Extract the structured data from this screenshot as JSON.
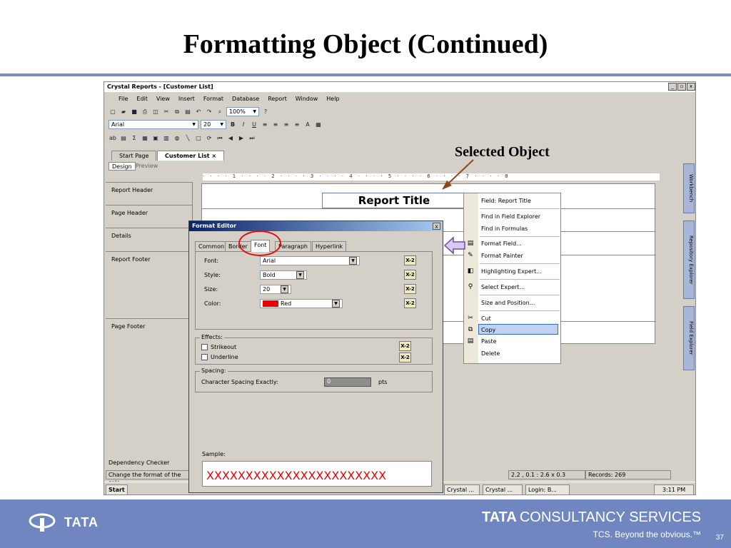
{
  "slide": {
    "title": "Formatting Object (Continued)",
    "annotation": "Selected Object",
    "page_number": "37"
  },
  "window": {
    "title": "Crystal Reports - [Customer List]",
    "buttons": [
      "_",
      " Γ",
      "x"
    ]
  },
  "menu": [
    "File",
    "Edit",
    "View",
    "Insert",
    "Format",
    "Database",
    "Report",
    "Window",
    "Help"
  ],
  "toolbar": {
    "zoom": "100%",
    "font": "Arial",
    "size": "20"
  },
  "doc_tabs": {
    "start": "Start Page",
    "current": "Customer List",
    "close": "×"
  },
  "view_tabs": {
    "design": "Design",
    "preview": "Preview"
  },
  "ruler": "· · · · 1 · · · · 2 · · · · 3 · · · · 4 · · · · 5 · · · · 6 · · · · 7 · · · · 8",
  "sections": [
    "Report Header",
    "Page Header",
    "Details",
    "Report Footer",
    "Page Footer"
  ],
  "report_title": "Report Title",
  "side_tabs": [
    "Workbench",
    "Repository Explorer",
    "Field Explorer"
  ],
  "dialog": {
    "title": "Format Editor",
    "tabs": [
      "Common",
      "Border",
      "Font",
      "Paragraph",
      "Hyperlink"
    ],
    "font_label": "Font:",
    "font_value": "Arial",
    "style_label": "Style:",
    "style_value": "Bold",
    "size_label": "Size:",
    "size_value": "20",
    "color_label": "Color:",
    "color_value": "Red",
    "formula_label": "X-2",
    "effects_label": "Effects:",
    "strikeout": "Strikeout",
    "underline": "Underline",
    "spacing_label": "Spacing:",
    "char_spacing_label": "Character Spacing Exactly:",
    "char_spacing_value": "0",
    "char_spacing_unit": "pts",
    "sample_label": "Sample:",
    "sample_text": "XXXXXXXXXXXXXXXXXXXXXXX"
  },
  "context_menu": {
    "header": "Field: Report Title",
    "items": [
      "Find in Field Explorer",
      "Find in Formulas",
      "Format Field...",
      "Format Painter",
      "Highlighting Expert...",
      "Select Expert...",
      "Size and Position...",
      "Cut",
      "Copy",
      "Paste",
      "Delete"
    ]
  },
  "status": {
    "dependency": "Dependency Checker",
    "message": "Change the format of the sele",
    "coords": "2.2 , 0.1 : 2.6 x 0.3",
    "records": "Records:  269"
  },
  "taskbar": {
    "start": "Start",
    "items": [
      "Crystal ...",
      "Crystal ...",
      "Login: B..."
    ],
    "clock": "3:11 PM"
  },
  "footer": {
    "logo": "TATA",
    "company_bold": "TATA",
    "company_rest": "CONSULTANCY SERVICES",
    "tagline": "TCS. Beyond the obvious.™"
  },
  "colors": {
    "rule": "#7b8cc3",
    "footer_bg": "#6f86c0",
    "highlight_circle": "#e01010",
    "sample_text": "#e00000"
  }
}
